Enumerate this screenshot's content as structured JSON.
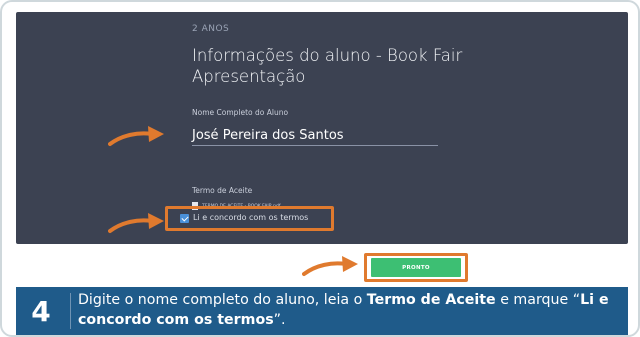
{
  "form": {
    "step_label": "2 ANOS",
    "title": "Informações do aluno - Book Fair Apresentação",
    "name_field_label": "Nome Completo do Aluno",
    "name_value": "José Pereira dos Santos",
    "terms_label": "Termo de Aceite",
    "terms_file": "TERMO DE ACEITE - BOOK FAIR.pdf",
    "agree_label": "Li e concordo com os termos",
    "agree_checked": true,
    "submit_label": "PRONTO"
  },
  "instruction": {
    "step_number": "4",
    "part1": "Digite o nome completo do aluno, leia o ",
    "bold1": "Termo de Aceite",
    "part2": " e marque “",
    "bold2": "Li e concordo com os termos",
    "part3": "”."
  },
  "colors": {
    "panel_bg": "#3c4252",
    "highlight_orange": "#e07a2e",
    "button_green": "#3dbf73",
    "checkbox_blue": "#4a90d9",
    "instruction_bg": "#1f5b8a"
  },
  "icons": [
    "pdf-file-icon",
    "checkbox-checked-icon",
    "orange-arrow-icon"
  ]
}
